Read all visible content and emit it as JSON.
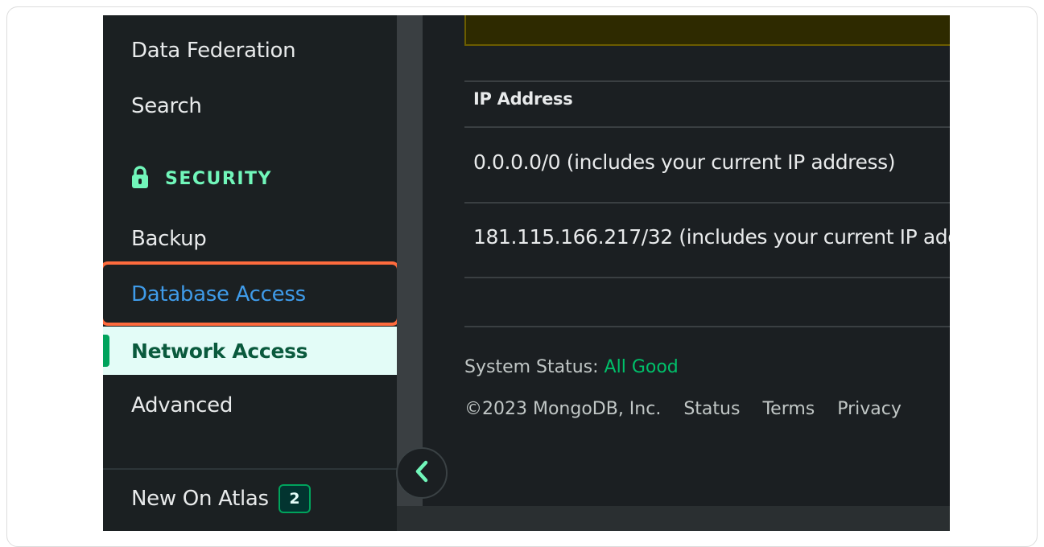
{
  "sidebar": {
    "items_top": [
      {
        "label": "Data Federation"
      },
      {
        "label": "Search"
      }
    ],
    "section": {
      "icon": "lock-icon",
      "label": "SECURITY"
    },
    "items_security": [
      {
        "label": "Backup"
      },
      {
        "label": "Database Access"
      },
      {
        "label": "Network Access",
        "active": true
      },
      {
        "label": "Advanced"
      }
    ],
    "new_on_atlas": {
      "label": "New On Atlas",
      "count": "2"
    }
  },
  "table": {
    "column_header": "IP Address",
    "rows": [
      {
        "ip": "0.0.0.0/0  (includes your current IP address)"
      },
      {
        "ip": "181.115.166.217/32  (includes your current IP add"
      }
    ]
  },
  "status": {
    "label": "System Status:",
    "value": "All Good"
  },
  "footer": {
    "copyright": "©2023 MongoDB, Inc.",
    "links": [
      "Status",
      "Terms",
      "Privacy"
    ]
  },
  "colors": {
    "accent_green": "#00a35c",
    "link_blue": "#3f9be9",
    "highlight_orange": "#ff6b3d",
    "section_green": "#71f6ba"
  }
}
